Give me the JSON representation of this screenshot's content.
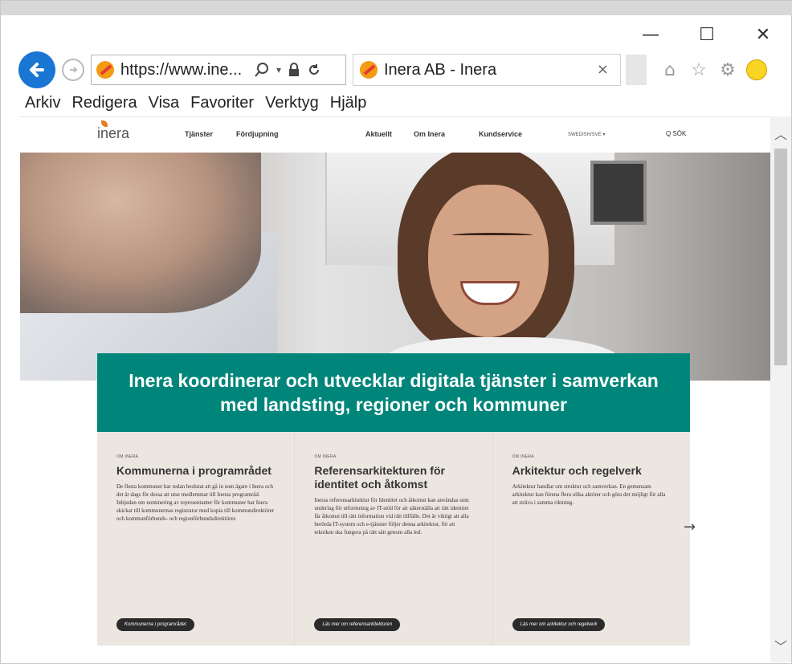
{
  "browser": {
    "address": "https://www.ine...",
    "tab_title": "Inera AB - Inera",
    "tab_close": "×",
    "window_controls": {
      "minimize": "—",
      "maximize": "☐",
      "close": "✕"
    },
    "menu": [
      "Arkiv",
      "Redigera",
      "Visa",
      "Favoriter",
      "Verktyg",
      "Hjälp"
    ]
  },
  "site": {
    "logo": "inera",
    "nav": [
      "Tjänster",
      "Fördjupning",
      "Aktuellt",
      "Om Inera",
      "Kundservice"
    ],
    "lang": "SWEDISH/SVE ▾",
    "search": "Q SÖK",
    "banner": "Inera koordinerar och utvecklar digitala tjänster i samverkan med landsting, regioner och kommuner",
    "cards": [
      {
        "kicker": "OM INERA",
        "title": "Kommunerna i programrådet",
        "body": "De flesta kommuner har redan beslutat att gå in som ägare i Inera och det är dags för dessa att utse medlemmar till Ineras programråd. Inbjudan om nominering av representanter för kommuner har Inera skickat till kommunernas registrator med kopia till kommundirektörer och kommunförbunds- och regionförbundsdirektörer.",
        "button": "Kommunerna i programrådet"
      },
      {
        "kicker": "OM INERA",
        "title": "Referensarkitekturen för identitet och åtkomst",
        "body": "Ineras referensarkitektur för Identitet och åtkomst kan användas som underlag för utformning av IT-stöd för att säkerställa att rätt identitet får åtkomst till rätt information vid rätt tillfälle. Det är viktigt att alla berörda IT-system och e-tjänster följer denna arkitektur, för att tekniken ska fungera på rätt sätt genom alla led.",
        "button": "Läs mer om referensarkitekturen"
      },
      {
        "kicker": "OM INERA",
        "title": "Arkitektur och regelverk",
        "body": "Arkitektur handlar om struktur och samverkan. En gemensam arkitektur kan förena flera olika aktörer och göra det möjligt för alla att sträva i samma riktning.",
        "button": "Läs mer om arkitektur och regelverk"
      }
    ],
    "next": "→"
  },
  "colors": {
    "banner": "#00857a",
    "back_button": "#1976d2",
    "cards_bg": "#ece6e1"
  }
}
